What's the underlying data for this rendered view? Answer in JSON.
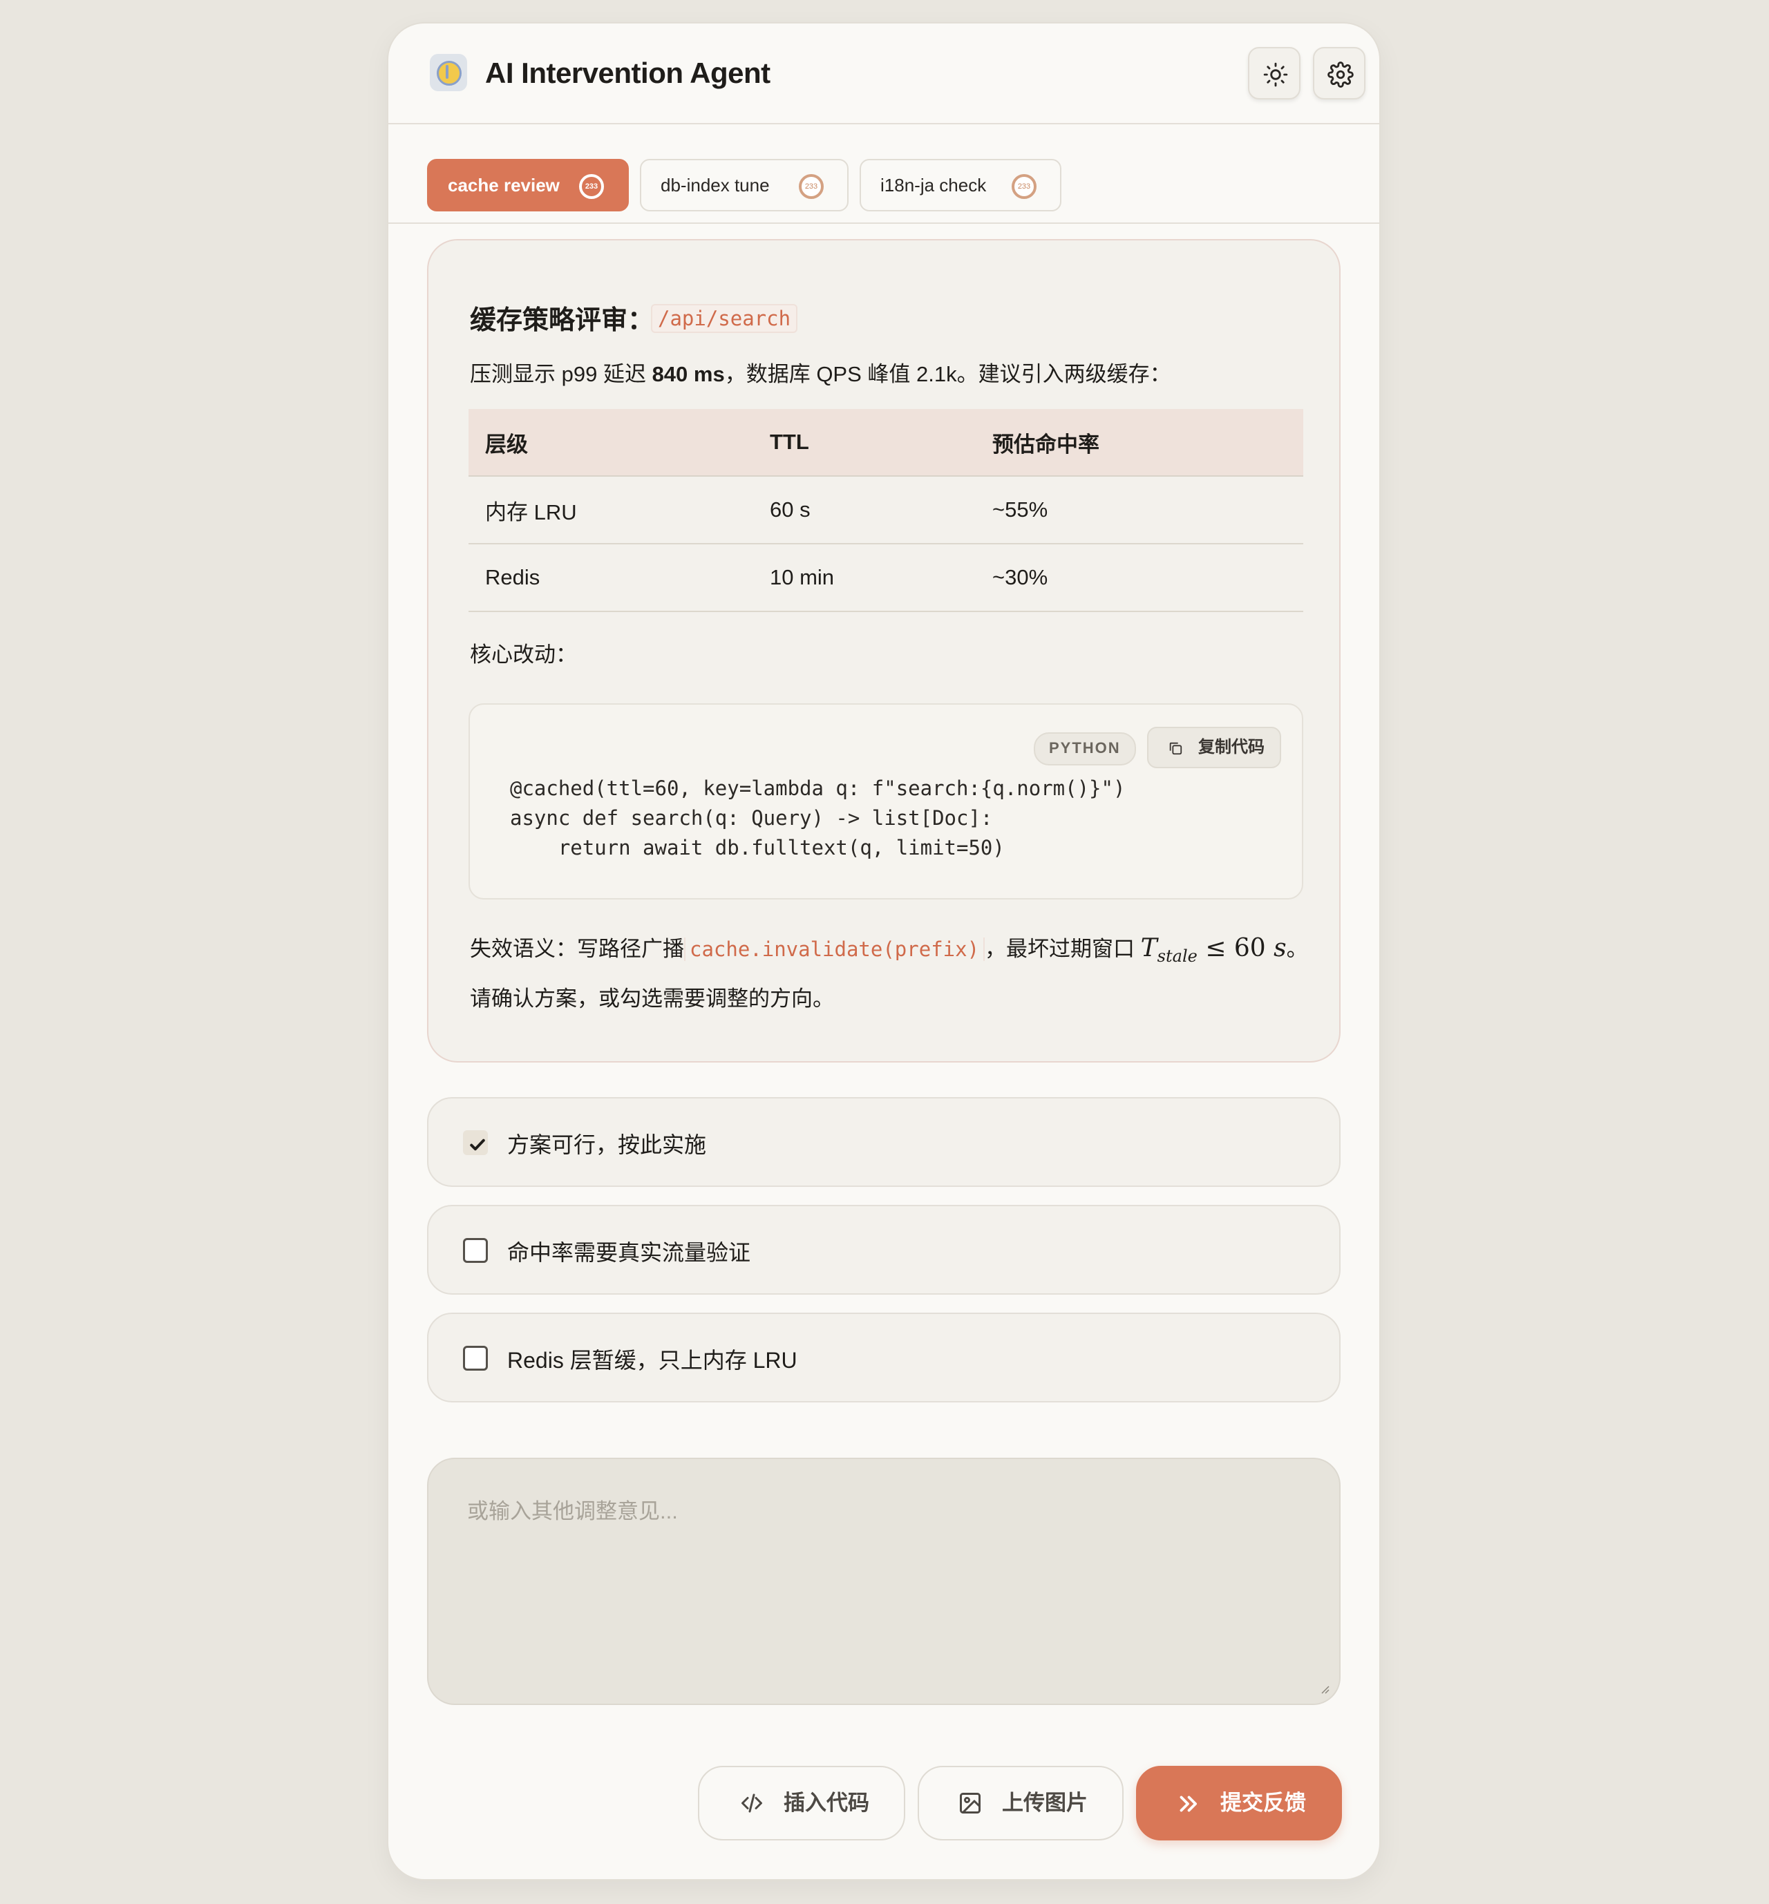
{
  "header": {
    "title": "AI Intervention Agent",
    "theme_icon": "sun-icon",
    "settings_icon": "gear-icon"
  },
  "tabs": [
    {
      "label": "cache review",
      "badge": "233",
      "active": true
    },
    {
      "label": "db-index tune",
      "badge": "233",
      "active": false
    },
    {
      "label": "i18n-ja check",
      "badge": "233",
      "active": false
    }
  ],
  "content": {
    "heading": "缓存策略评审：",
    "heading_path": "/api/search",
    "intro_a": "压测显示 p99 延迟 ",
    "intro_bold": "840 ms",
    "intro_b": "，数据库 QPS 峰值 2.1k。建议引入两级缓存：",
    "table": {
      "headers": [
        "层级",
        "TTL",
        "预估命中率"
      ],
      "rows": [
        [
          "内存 LRU",
          "60 s",
          "~55%"
        ],
        [
          "Redis",
          "10 min",
          "~30%"
        ]
      ]
    },
    "core_label": "核心改动：",
    "code_lang": "PYTHON",
    "copy_label": "复制代码",
    "code": "@cached(ttl=60, key=lambda q: f\"search:{q.norm()}\")\nasync def search(q: Query) -> list[Doc]:\n    return await db.fulltext(q, limit=50)",
    "invalidation_a": "失效语义：写路径广播",
    "invalidation_code": "cache.invalidate(prefix)",
    "invalidation_b": "，最坏过期窗口 ",
    "math_T": "T",
    "math_sub": "stale",
    "math_rest": " ≤ 60 ",
    "math_s": "s",
    "invalidation_end": "。",
    "confirm_text": "请确认方案，或勾选需要调整的方向。"
  },
  "options": [
    {
      "label": "方案可行，按此实施",
      "checked": true
    },
    {
      "label": "命中率需要真实流量验证",
      "checked": false
    },
    {
      "label": "Redis 层暂缓，只上内存 LRU",
      "checked": false
    }
  ],
  "feedback": {
    "placeholder": "或输入其他调整意见..."
  },
  "actions": {
    "insert_code": "插入代码",
    "upload_image": "上传图片",
    "submit": "提交反馈"
  },
  "colors": {
    "accent": "#d97757",
    "background": "#e9e6df",
    "panel": "#faf9f6"
  }
}
